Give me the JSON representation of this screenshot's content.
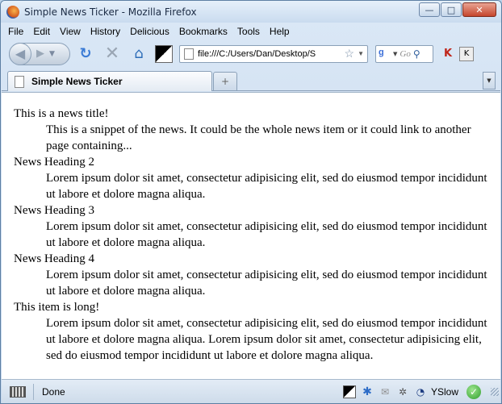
{
  "window": {
    "title": "Simple News Ticker - Mozilla Firefox",
    "minimize_glyph": "—",
    "maximize_glyph": "□",
    "close_glyph": "✕"
  },
  "menubar": {
    "items": [
      "File",
      "Edit",
      "View",
      "History",
      "Delicious",
      "Bookmarks",
      "Tools",
      "Help"
    ]
  },
  "navbar": {
    "url": "file:///C:/Users/Dan/Desktop/S",
    "search_placeholder": "Go",
    "search_engine_icon": "google-icon"
  },
  "tabs": {
    "items": [
      {
        "label": "Simple News Ticker",
        "active": true
      }
    ],
    "new_tab_glyph": "+"
  },
  "content": {
    "items": [
      {
        "title": "This is a news title!",
        "body": "This is a snippet of the news. It could be the whole news item or it could link to another page containing..."
      },
      {
        "title": "News Heading 2",
        "body": "Lorem ipsum dolor sit amet, consectetur adipisicing elit, sed do eiusmod tempor incididunt ut labore et dolore magna aliqua."
      },
      {
        "title": "News Heading 3",
        "body": "Lorem ipsum dolor sit amet, consectetur adipisicing elit, sed do eiusmod tempor incididunt ut labore et dolore magna aliqua."
      },
      {
        "title": "News Heading 4",
        "body": "Lorem ipsum dolor sit amet, consectetur adipisicing elit, sed do eiusmod tempor incididunt ut labore et dolore magna aliqua."
      },
      {
        "title": "This item is long!",
        "body": "Lorem ipsum dolor sit amet, consectetur adipisicing elit, sed do eiusmod tempor incididunt ut labore et dolore magna aliqua. Lorem ipsum dolor sit amet, consectetur adipisicing elit, sed do eiusmod tempor incididunt ut labore et dolore magna aliqua."
      }
    ]
  },
  "statusbar": {
    "status": "Done",
    "yslow_label": "YSlow"
  },
  "colors": {
    "chrome_blue": "#c3d7ee",
    "close_red": "#c5452c",
    "reload_blue": "#3a7bd5"
  }
}
